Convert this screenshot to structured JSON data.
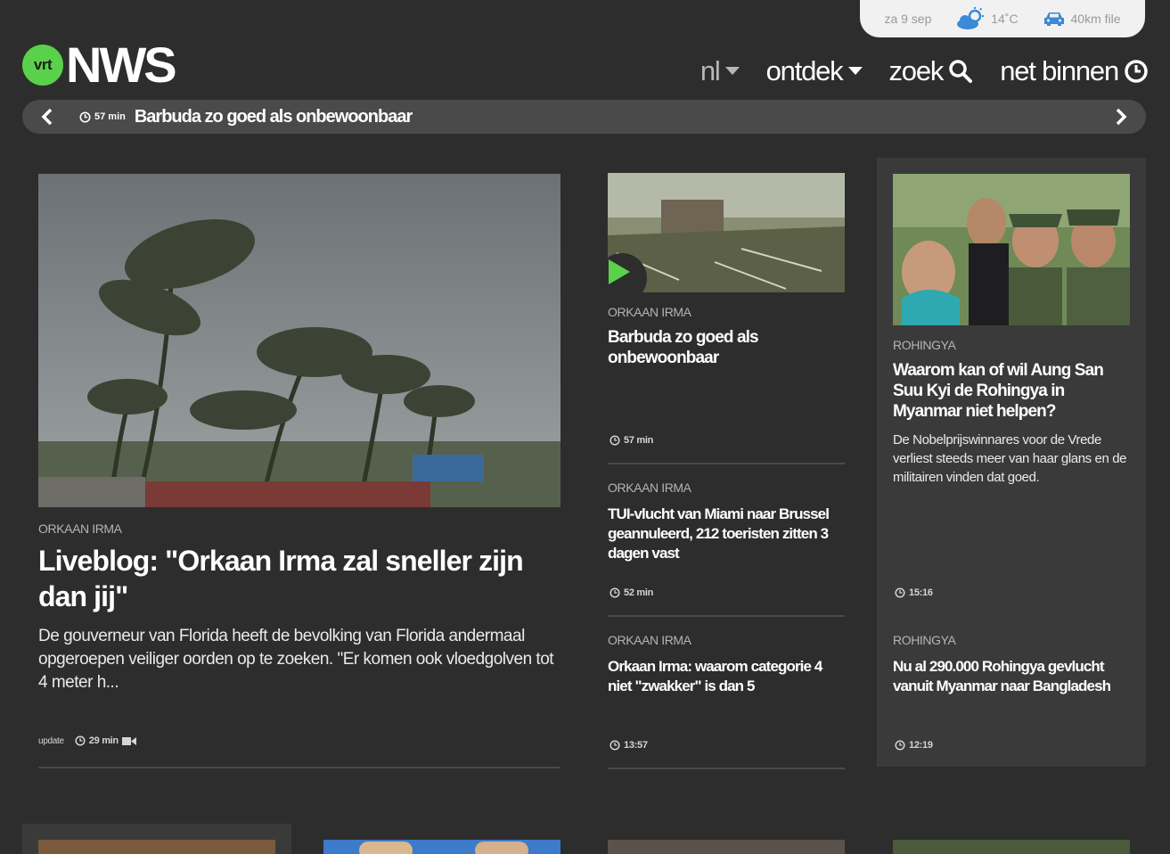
{
  "topbar": {
    "date": "za 9 sep",
    "temperature": "14˚C",
    "traffic": "40km file"
  },
  "logo": {
    "badge": "vrt",
    "name": "NWS"
  },
  "nav": [
    {
      "label": "nl",
      "icon": "chevron-down-icon"
    },
    {
      "label": "ontdek",
      "icon": "chevron-down-icon"
    },
    {
      "label": "zoek",
      "icon": "search-icon"
    },
    {
      "label": "net binnen",
      "icon": "clock-icon"
    }
  ],
  "ticker": {
    "time": "57 min",
    "title": "Barbuda zo goed als onbewoonbaar"
  },
  "lead": {
    "kicker": "ORKAAN IRMA",
    "title": "Liveblog: \"Orkaan Irma zal sneller zijn dan jij\"",
    "summary": "De gouverneur van Florida heeft de bevolking van Florida andermaal opgeroepen veiliger oorden op te zoeken. \"Er komen ook vloedgolven tot 4 meter h...",
    "update": "update",
    "time": "29 min"
  },
  "middle": [
    {
      "kicker": "ORKAAN IRMA",
      "title": "Barbuda zo goed als onbewoonbaar",
      "time": "57 min"
    },
    {
      "kicker": "ORKAAN IRMA",
      "title": "TUI-vlucht van Miami naar Brussel geannuleerd, 212 toeristen zitten 3 dagen vast",
      "time": "52 min"
    },
    {
      "kicker": "ORKAAN IRMA",
      "title": "Orkaan Irma: waarom categorie 4 niet \"zwakker\" is dan 5",
      "time": "13:57"
    }
  ],
  "right": [
    {
      "kicker": "ROHINGYA",
      "title": "Waarom kan of wil Aung San Suu Kyi de Rohingya in Myanmar niet helpen?",
      "summary": "De Nobelprijswinnares voor de Vrede verliest steeds meer van haar glans en de militairen vinden dat goed.",
      "time": "15:16"
    },
    {
      "kicker": "ROHINGYA",
      "title": "Nu al 290.000 Rohingya gevlucht vanuit Myanmar naar Bangladesh",
      "time": "12:19"
    }
  ],
  "colors": {
    "background": "#2d2d2d",
    "accent": "#5ad14a",
    "panel": "#3a3a3a"
  }
}
